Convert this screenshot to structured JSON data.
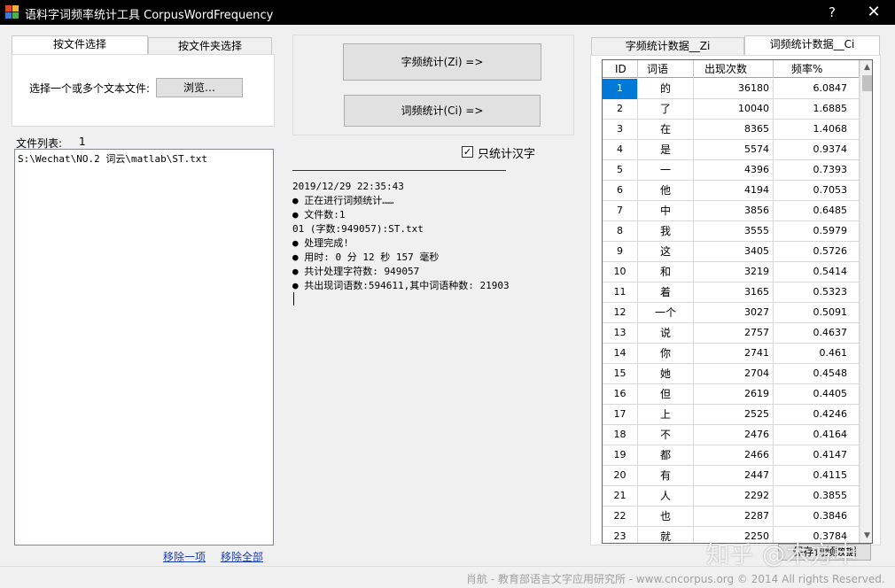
{
  "window": {
    "title": "语料字词频率统计工具 CorpusWordFrequency",
    "help": "?",
    "close": "✕"
  },
  "left": {
    "tab_file": "按文件选择",
    "tab_folder": "按文件夹选择",
    "select_label": "选择一个或多个文本文件:",
    "browse": "浏览…",
    "filelist_label": "文件列表:",
    "filelist_count": "1",
    "files": [
      "S:\\Wechat\\NO.2 词云\\matlab\\ST.txt"
    ],
    "remove_one": "移除一项",
    "remove_all": "移除全部"
  },
  "middle": {
    "zi_button": "字频统计(Zi) =>",
    "ci_button": "词频统计(Ci) =>",
    "only_hanzi_checked": true,
    "only_hanzi_label": "只统计汉字",
    "log": [
      "2019/12/29 22:35:43",
      "● 正在进行词频统计……",
      "● 文件数:1",
      "01 (字数:949057):ST.txt",
      "● 处理完成!",
      "● 用时: 0 分 12 秒 157 毫秒",
      "● 共计处理字符数: 949057",
      "● 共出现词语数:594611,其中词语种数: 21903"
    ]
  },
  "right": {
    "tab_zi": "字频统计数据__Zi",
    "tab_ci": "词频统计数据__Ci",
    "columns": [
      "ID",
      "词语",
      "出现次数",
      "频率%"
    ],
    "rows": [
      [
        "1",
        "的",
        "36180",
        "6.0847"
      ],
      [
        "2",
        "了",
        "10040",
        "1.6885"
      ],
      [
        "3",
        "在",
        "8365",
        "1.4068"
      ],
      [
        "4",
        "是",
        "5574",
        "0.9374"
      ],
      [
        "5",
        "一",
        "4396",
        "0.7393"
      ],
      [
        "6",
        "他",
        "4194",
        "0.7053"
      ],
      [
        "7",
        "中",
        "3856",
        "0.6485"
      ],
      [
        "8",
        "我",
        "3555",
        "0.5979"
      ],
      [
        "9",
        "这",
        "3405",
        "0.5726"
      ],
      [
        "10",
        "和",
        "3219",
        "0.5414"
      ],
      [
        "11",
        "着",
        "3165",
        "0.5323"
      ],
      [
        "12",
        "一个",
        "3027",
        "0.5091"
      ],
      [
        "13",
        "说",
        "2757",
        "0.4637"
      ],
      [
        "14",
        "你",
        "2741",
        "0.461"
      ],
      [
        "15",
        "她",
        "2704",
        "0.4548"
      ],
      [
        "16",
        "但",
        "2619",
        "0.4405"
      ],
      [
        "17",
        "上",
        "2525",
        "0.4246"
      ],
      [
        "18",
        "不",
        "2476",
        "0.4164"
      ],
      [
        "19",
        "都",
        "2466",
        "0.4147"
      ],
      [
        "20",
        "有",
        "2447",
        "0.4115"
      ],
      [
        "21",
        "人",
        "2292",
        "0.3855"
      ],
      [
        "22",
        "也",
        "2287",
        "0.3846"
      ],
      [
        "23",
        "就",
        "2250",
        "0.3784"
      ]
    ],
    "save_button": "保存词频数据"
  },
  "footer": "肖航 - 教育部语言文字应用研究所 - www.cncorpus.org © 2014 All rights Reserved.",
  "watermark": "知乎 @木方申"
}
